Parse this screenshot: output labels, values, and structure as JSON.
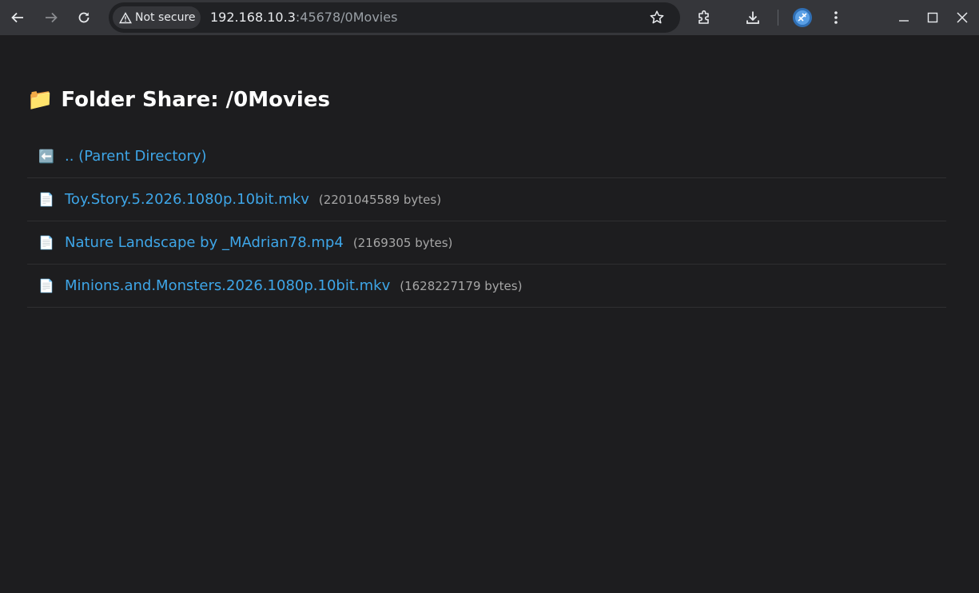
{
  "browser": {
    "security_chip": "Not secure",
    "url_host": "192.168.10.3",
    "url_rest": ":45678/0Movies",
    "icons": [
      "back-icon",
      "forward-icon",
      "reload-icon",
      "warning-icon",
      "star-icon",
      "extensions-icon",
      "download-icon",
      "profile-icon",
      "menu-icon",
      "minimize-icon",
      "maximize-icon",
      "close-icon"
    ]
  },
  "page": {
    "title_icon": "📁",
    "title": "Folder Share: /0Movies",
    "entries": [
      {
        "icon": "⬅️",
        "name": ".. (Parent Directory)",
        "size": ""
      },
      {
        "icon": "📄",
        "name": "Toy.Story.5.2026.1080p.10bit.mkv",
        "size": "(2201045589 bytes)"
      },
      {
        "icon": "📄",
        "name": "Nature Landscape by _MAdrian78.mp4",
        "size": "(2169305 bytes)"
      },
      {
        "icon": "📄",
        "name": "Minions.and.Monsters.2026.1080p.10bit.mkv",
        "size": "(1628227179 bytes)"
      }
    ]
  },
  "colors": {
    "link": "#3ea6e8",
    "background": "#1d1d1f",
    "toolbar": "#35363a"
  }
}
